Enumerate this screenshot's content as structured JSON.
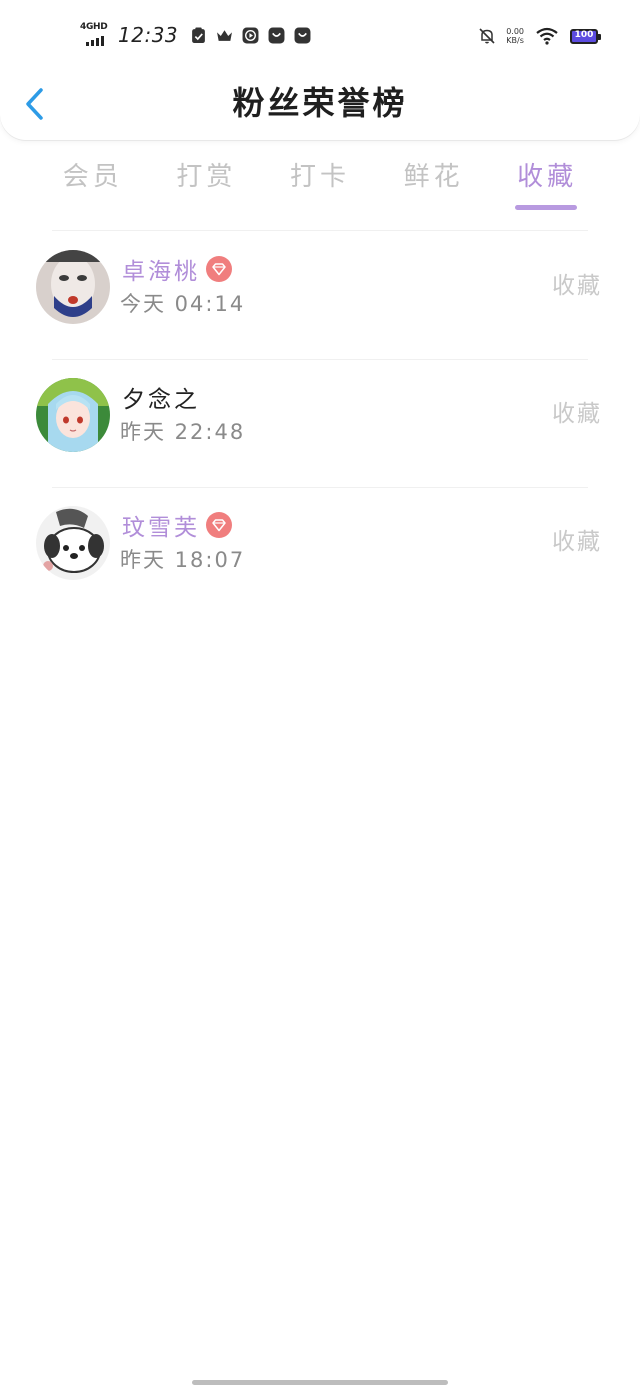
{
  "status_bar": {
    "network": "4GHD",
    "time": "12:33",
    "speed_value": "0.00",
    "speed_unit": "KB/s",
    "battery": "100",
    "battery_color": "#5c4ce0"
  },
  "header": {
    "title": "粉丝荣誉榜",
    "back_icon": "chevron-left-icon",
    "back_color": "#2d9be6"
  },
  "tabs": [
    {
      "label": "会员",
      "active": false
    },
    {
      "label": "打赏",
      "active": false
    },
    {
      "label": "打卡",
      "active": false
    },
    {
      "label": "鲜花",
      "active": false
    },
    {
      "label": "收藏",
      "active": true
    }
  ],
  "accent_color": "#b18ed9",
  "list": [
    {
      "name": "卓海桃",
      "vip": true,
      "time": "今天 04:14",
      "action": "收藏"
    },
    {
      "name": "夕念之",
      "vip": false,
      "time": "昨天 22:48",
      "action": "收藏"
    },
    {
      "name": "玟雪芙",
      "vip": true,
      "time": "昨天 18:07",
      "action": "收藏"
    }
  ]
}
